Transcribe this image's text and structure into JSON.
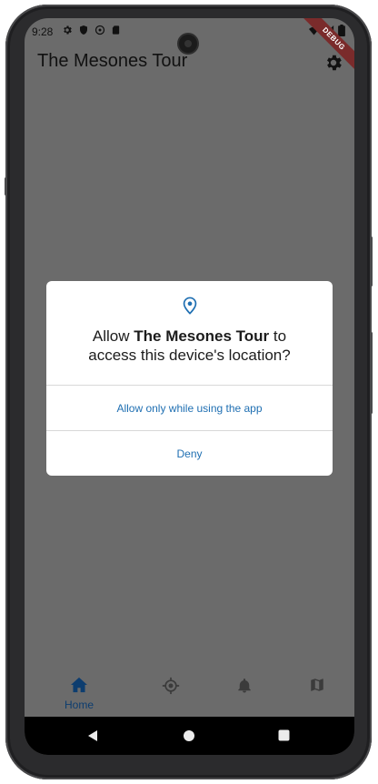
{
  "status_bar": {
    "time": "9:28",
    "left_icons": [
      "gear-icon",
      "shield-icon",
      "at-icon",
      "sd-card-icon"
    ],
    "right_icons": [
      "wifi-icon",
      "signal-icon",
      "battery-icon"
    ]
  },
  "debug_banner": "DEBUG",
  "app_bar": {
    "title": "The Mesones Tour",
    "action_icon": "settings-icon"
  },
  "dialog": {
    "icon": "location-pin-icon",
    "message_prefix": "Allow ",
    "app_name": "The Mesones Tour",
    "message_suffix": " to",
    "message_line2": "access this device's location?",
    "allow_label": "Allow only while using the app",
    "deny_label": "Deny"
  },
  "bottom_nav": {
    "items": [
      {
        "label": "Home",
        "icon": "home-icon",
        "active": true
      },
      {
        "label": "",
        "icon": "location-target-icon",
        "active": false
      },
      {
        "label": "",
        "icon": "bell-icon",
        "active": false
      },
      {
        "label": "",
        "icon": "map-icon",
        "active": false
      }
    ]
  },
  "system_nav": [
    "back-icon",
    "home-circle-icon",
    "recents-icon"
  ],
  "colors": {
    "accent": "#1f6fb2",
    "nav_active": "#0d3d6f",
    "scrim": "#6b6b6b"
  }
}
